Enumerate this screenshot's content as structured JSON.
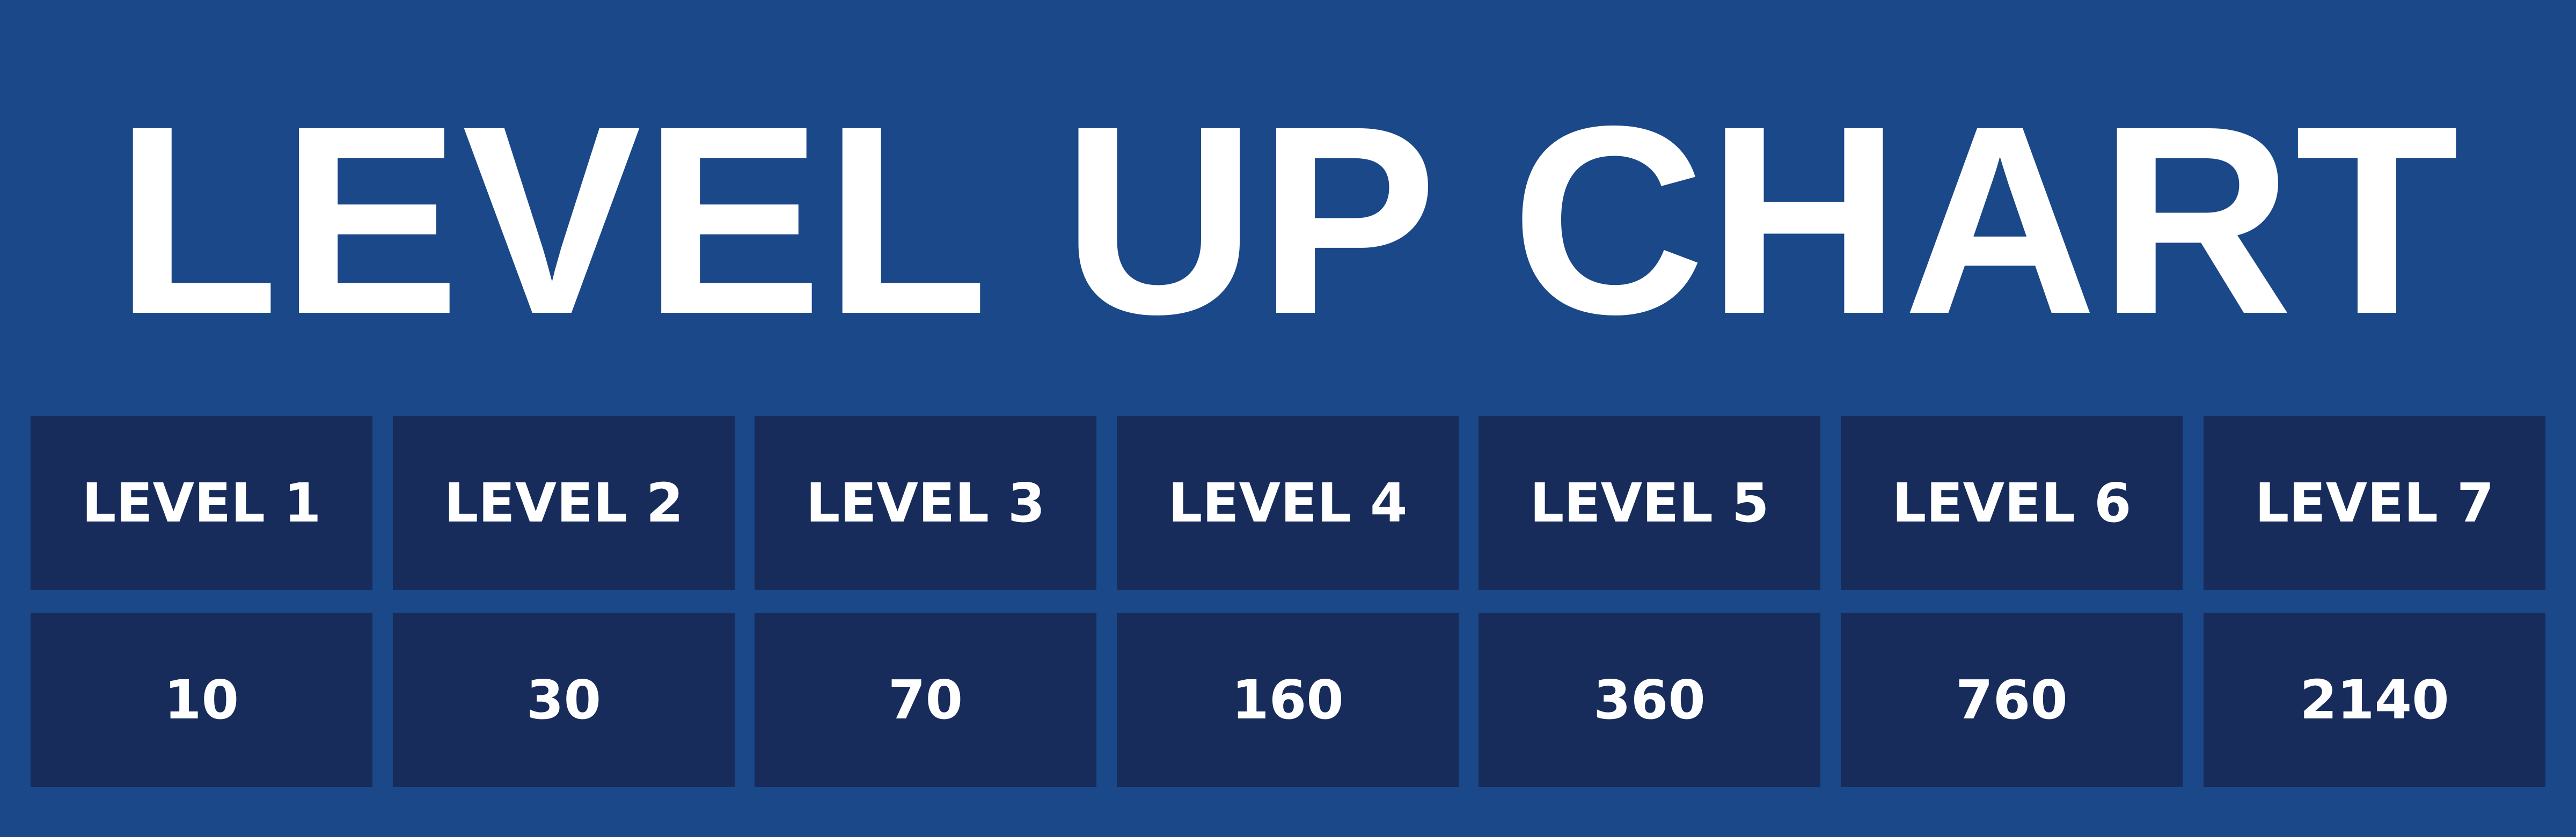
{
  "colors": {
    "background": "#1a4888",
    "cell": "#172c5b",
    "text": "#ffffff"
  },
  "title": "LEVEL UP CHART",
  "chart_data": {
    "type": "table",
    "title": "LEVEL UP CHART",
    "columns": [
      "LEVEL 1",
      "LEVEL 2",
      "LEVEL 3",
      "LEVEL 4",
      "LEVEL 5",
      "LEVEL 6",
      "LEVEL 7"
    ],
    "values": [
      "10",
      "30",
      "70",
      "160",
      "360",
      "760",
      "2140"
    ]
  }
}
